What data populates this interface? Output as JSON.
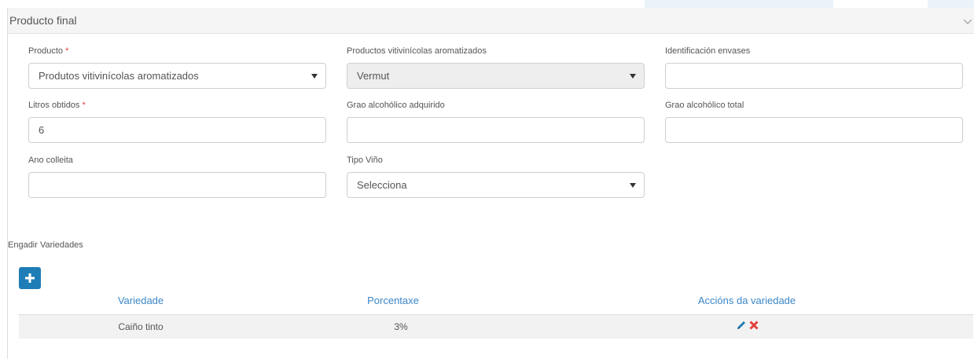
{
  "panel": {
    "title": "Producto final"
  },
  "form": {
    "producto": {
      "label": "Producto",
      "required_mark": "*",
      "value": "Produtos vitivinícolas aromatizados"
    },
    "productos_aromatizados": {
      "label": "Productos vitivinícolas aromatizados",
      "value": "Vermut"
    },
    "identificacion_envases": {
      "label": "Identificación envases",
      "value": ""
    },
    "litros_obtidos": {
      "label": "Litros obtidos",
      "required_mark": "*",
      "value": "6"
    },
    "grao_adquirido": {
      "label": "Grao alcohólico adquirido",
      "value": ""
    },
    "grao_total": {
      "label": "Grao alcohólico total",
      "value": ""
    },
    "ano_colleita": {
      "label": "Ano colleita",
      "value": ""
    },
    "tipo_vino": {
      "label": "Tipo Viño",
      "value": "Selecciona"
    }
  },
  "varieties": {
    "section_label": "Engadir Variedades",
    "add_icon": "plus-icon",
    "columns": [
      "Variedade",
      "Porcentaxe",
      "Accións da variedade"
    ],
    "rows": [
      {
        "variedade": "Caiño tinto",
        "porcentaxe": "3%",
        "actions": [
          "pencil-icon",
          "delete-x-icon"
        ]
      }
    ]
  },
  "colors": {
    "accent": "#1e7db6",
    "header_text": "#3a87c6",
    "delete": "#e4403c",
    "required": "#e4403c"
  }
}
